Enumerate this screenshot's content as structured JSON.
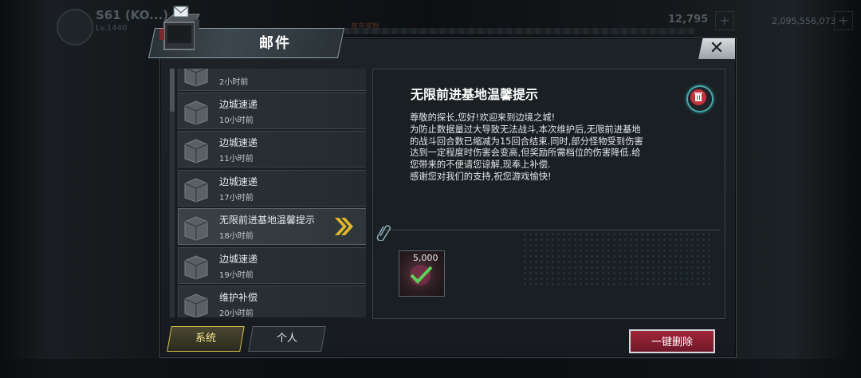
{
  "background": {
    "player_name": "S61 (KO...)",
    "player_sub": "Lv.1440",
    "resource_1": "12,795",
    "resource_2": "2,095,556,073",
    "tag_text": "首充奖励"
  },
  "modal": {
    "title": "邮件",
    "close_label": "✕"
  },
  "mail_list": [
    {
      "title": "",
      "time": "2小时前",
      "selected": false
    },
    {
      "title": "边城速递",
      "time": "10小时前",
      "selected": false
    },
    {
      "title": "边城速递",
      "time": "11小时前",
      "selected": false
    },
    {
      "title": "边城速递",
      "time": "17小时前",
      "selected": false
    },
    {
      "title": "无限前进基地温馨提示",
      "time": "18小时前",
      "selected": true
    },
    {
      "title": "边城速递",
      "time": "19小时前",
      "selected": false
    },
    {
      "title": "维护补偿",
      "time": "20小时前",
      "selected": false
    }
  ],
  "detail": {
    "title": "无限前进基地温馨提示",
    "body_lines": [
      "尊敬的探长,您好!欢迎来到边境之城!",
      "为防止数据量过大导致无法战斗,本次维护后,无限前进基地",
      "的战斗回合数已缩减为15回合结束.同时,部分怪物受到伤害",
      "达到一定程度时伤害会变高,但奖励所需档位的伤害降低.给",
      "您带来的不便请您谅解,现奉上补偿.",
      "感谢您对我们的支持,祝您游戏愉快!"
    ],
    "reward_amount": "5,000"
  },
  "tabs": {
    "system": "系统",
    "personal": "个人"
  },
  "actions": {
    "delete_all": "一键删除"
  },
  "colors": {
    "tab_active_border": "#d8c24a",
    "delete_button": "#a02538",
    "trash_ring": "#4aa7a9"
  }
}
